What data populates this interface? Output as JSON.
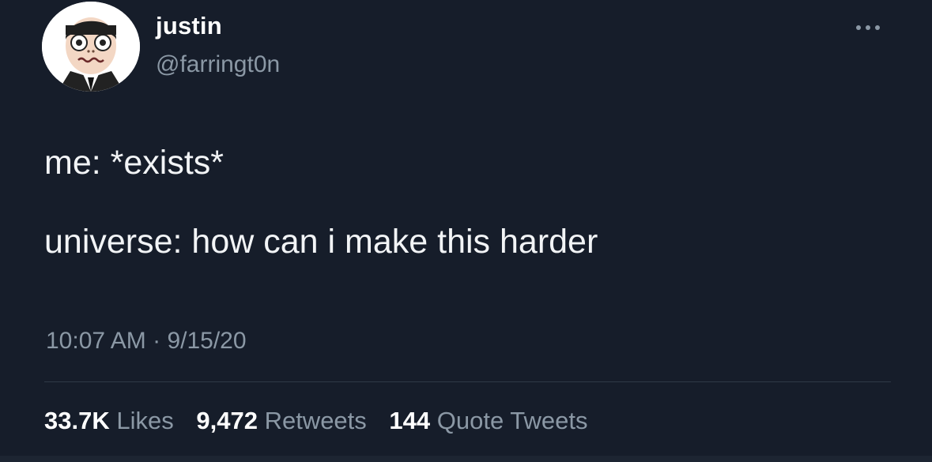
{
  "user": {
    "name": "justin",
    "handle": "@farringt0n",
    "avatar_icon": "cartoon-face-avatar"
  },
  "menu_icon": "more-options-icon",
  "tweet": {
    "lines": [
      "me: *exists*",
      "universe: how can i make this harder"
    ],
    "time": "10:07 AM",
    "separator": "·",
    "date": "9/15/20"
  },
  "stats": {
    "likes_count": "33.7K",
    "likes_label": "Likes",
    "retweets_count": "9,472",
    "retweets_label": "Retweets",
    "quotes_count": "144",
    "quotes_label": "Quote Tweets"
  },
  "colors": {
    "background": "#161d2a",
    "text": "#f2f4f6",
    "secondary_text": "#8b98a5",
    "divider": "#2f3946"
  }
}
